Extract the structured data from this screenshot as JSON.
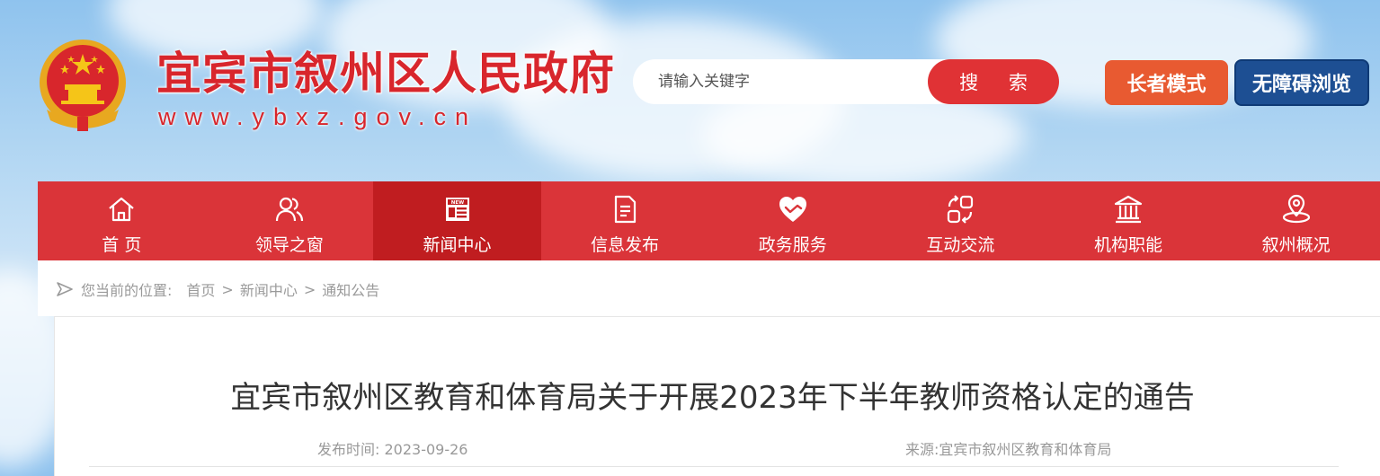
{
  "header": {
    "site_title": "宜宾市叙州区人民政府",
    "site_url": "www.ybxz.gov.cn",
    "search": {
      "placeholder": "请输入关键字",
      "button_label": "搜 索"
    },
    "elder_mode_label": "长者模式",
    "accessibility_label": "无障碍浏览"
  },
  "nav": {
    "items": [
      {
        "label": "首 页",
        "icon": "home-icon"
      },
      {
        "label": "领导之窗",
        "icon": "people-icon"
      },
      {
        "label": "新闻中心",
        "icon": "news-icon",
        "active": true
      },
      {
        "label": "信息发布",
        "icon": "document-icon"
      },
      {
        "label": "政务服务",
        "icon": "heart-hands-icon"
      },
      {
        "label": "互动交流",
        "icon": "exchange-icon"
      },
      {
        "label": "机构职能",
        "icon": "institution-icon"
      },
      {
        "label": "叙州概况",
        "icon": "location-icon"
      }
    ]
  },
  "breadcrumb": {
    "lead": "您当前的位置:",
    "items": [
      "首页",
      "新闻中心",
      "通知公告"
    ],
    "separator": ">"
  },
  "article": {
    "title": "宜宾市叙州区教育和体育局关于开展2023年下半年教师资格认定的通告",
    "publish_label": "发布时间:",
    "publish_date": "2023-09-26",
    "source_label": "来源:",
    "source": "宜宾市叙州区教育和体育局"
  },
  "colors": {
    "brand_red": "#da3439",
    "nav_active": "#c01d20",
    "elder_orange": "#e85a31",
    "access_blue": "#1d4f93"
  }
}
